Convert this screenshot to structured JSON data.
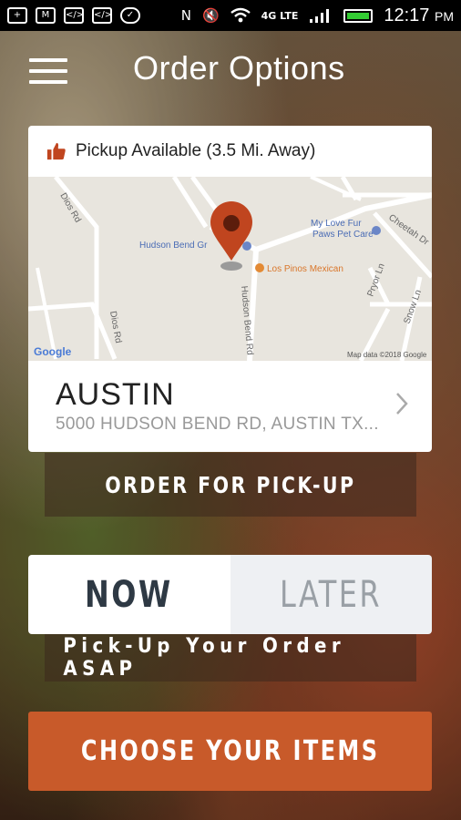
{
  "status_bar": {
    "time": "12:17",
    "ampm": "PM",
    "network": "4G LTE",
    "icons": [
      "plus-icon",
      "gmail-icon",
      "code-icon",
      "code-icon",
      "chat-icon",
      "nfc-icon",
      "mute-icon",
      "wifi-icon",
      "signal-icon",
      "battery-icon"
    ]
  },
  "header": {
    "title": "Order Options",
    "menu_icon": "hamburger-icon"
  },
  "location_card": {
    "pickup_label": "Pickup Available (3.5 Mi. Away)",
    "pickup_icon": "thumbs-up-icon",
    "map": {
      "labels": {
        "dios_rd_top": "Dios Rd",
        "dios_rd_bottom": "Dios Rd",
        "hudson_bend_grill": "Hudson Bend Gr",
        "pet_care_line1": "My Love Fur",
        "pet_care_line2": "Paws Pet Care",
        "los_pinos": "Los Pinos Mexican",
        "hudson_bend_rd": "Hudson Bend Rd",
        "cheetah_dr": "Cheetah Dr",
        "pryor_ln": "Pryor Ln",
        "snow_ln": "Snow Ln",
        "google": "Google",
        "map_data": "Map data ©2018 Google"
      }
    },
    "city": "AUSTIN",
    "address": "5000 HUDSON BEND RD, AUSTIN TX..."
  },
  "order_button": {
    "label": "ORDER FOR PICK-UP"
  },
  "timing_toggle": {
    "now": "NOW",
    "later": "LATER",
    "selected": "NOW"
  },
  "asap_text": "Pick-Up Your Order ASAP",
  "choose_button": {
    "label": "CHOOSE YOUR ITEMS"
  },
  "colors": {
    "accent": "#c85a2a",
    "pin": "#c0451f",
    "toggle_active_text": "#2e3944"
  }
}
